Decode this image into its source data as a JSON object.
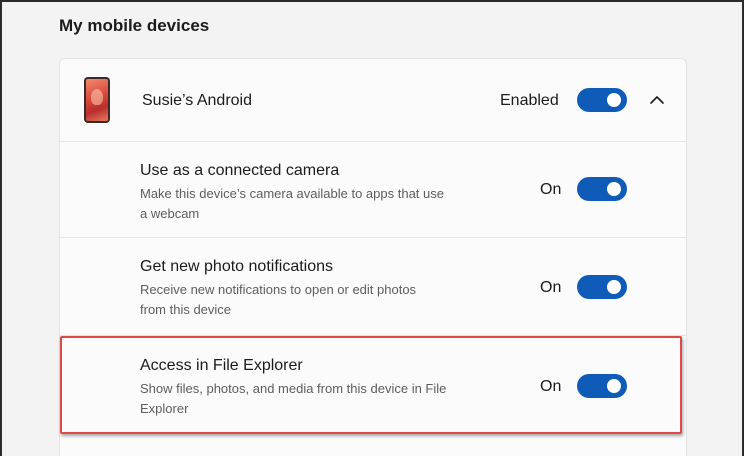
{
  "section": {
    "title": "My mobile devices"
  },
  "device": {
    "name": "Susie’s Android",
    "state_label": "Enabled",
    "icon": "phone-thumbnail-icon",
    "expand_icon": "chevron-up-icon"
  },
  "options": [
    {
      "title": "Use as a connected camera",
      "desc_line1": "Make this device’s camera available to apps that use",
      "desc_line2": "a webcam",
      "state_label": "On"
    },
    {
      "title": "Get new photo notifications",
      "desc_line1": "Receive new notifications to open or edit photos",
      "desc_line2": "from this device",
      "state_label": "On"
    },
    {
      "title": "Access in File Explorer",
      "desc_line1": "Show files, photos, and media from this device in File",
      "desc_line2": "Explorer",
      "state_label": "On"
    }
  ],
  "colors": {
    "toggle_on": "#0f5cb8",
    "highlight_border": "#e04848",
    "page_bg": "#f3f3f3",
    "card_bg": "#fbfbfb"
  }
}
